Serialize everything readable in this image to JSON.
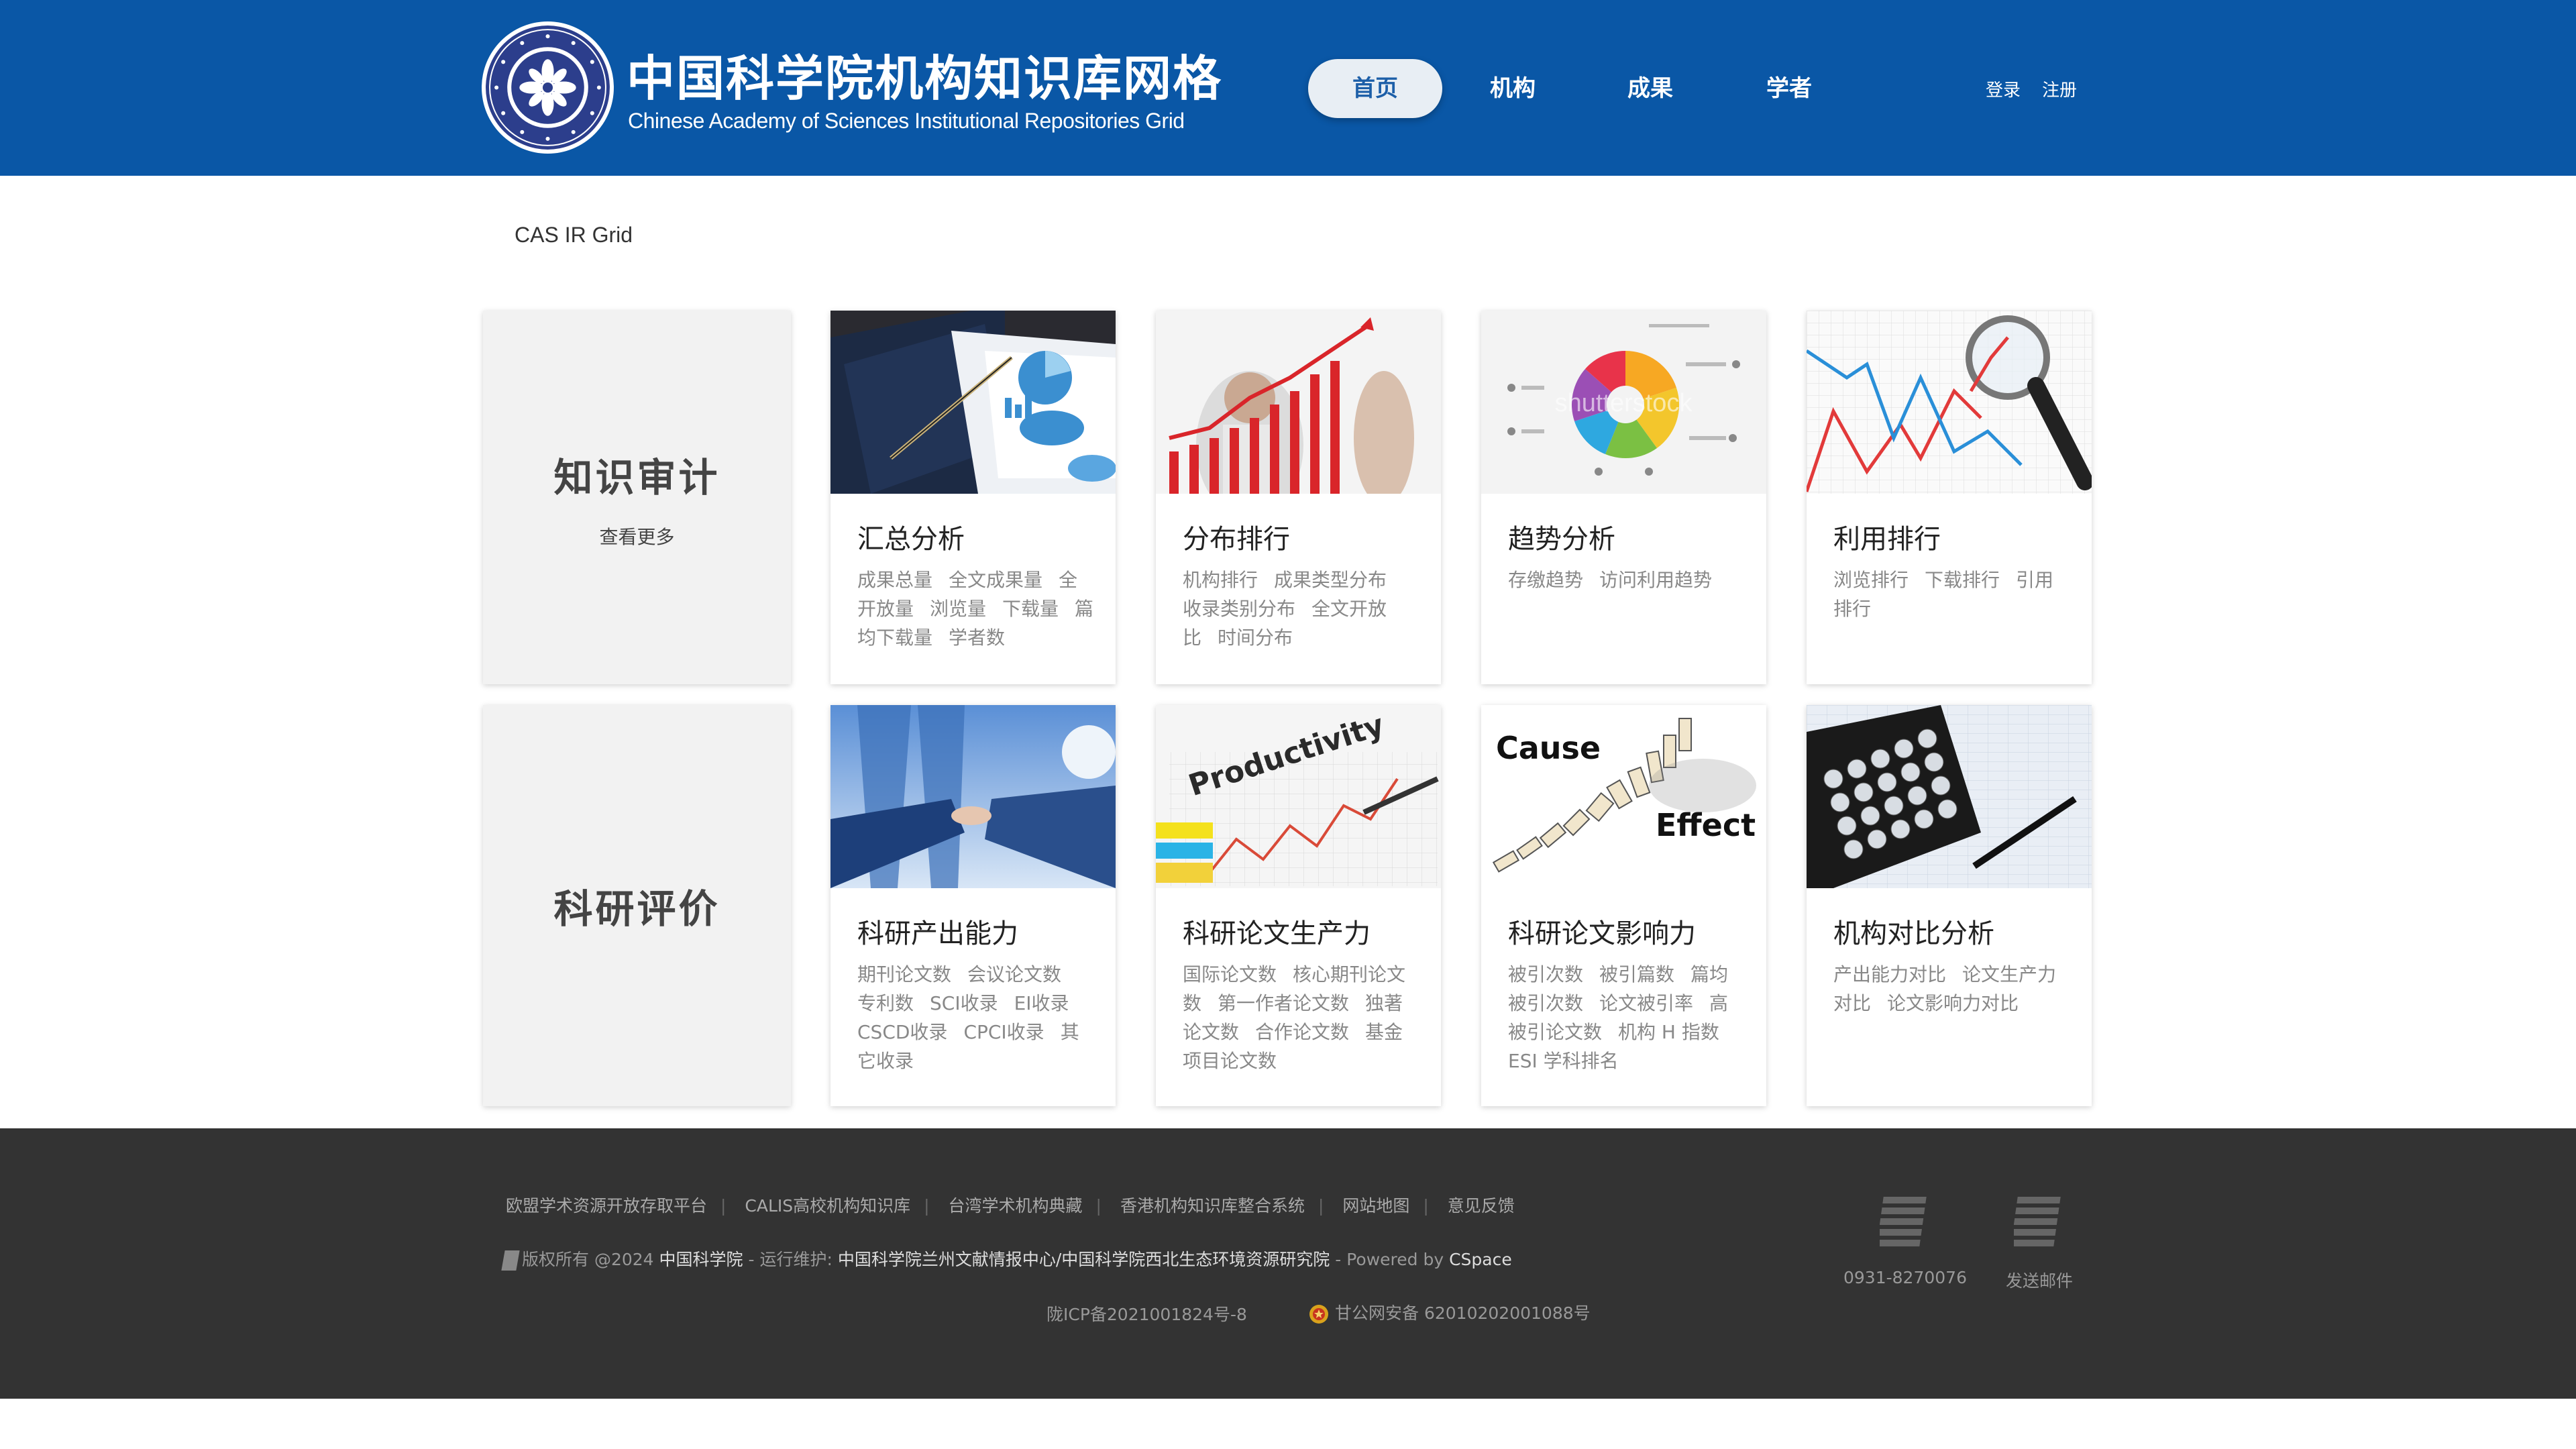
{
  "header": {
    "logo_name": "中国科学院 CHINESE ACADEMY OF SCIENCES",
    "title_cn": "中国科学院机构知识库网格",
    "title_en": "Chinese Academy of Sciences Institutional Repositories Grid",
    "nav": [
      {
        "label": "首页",
        "active": true
      },
      {
        "label": "机构",
        "active": false
      },
      {
        "label": "成果",
        "active": false
      },
      {
        "label": "学者",
        "active": false
      }
    ],
    "login": "登录",
    "register": "注册",
    "colors": {
      "header_bg": "#0a57a6",
      "active_nav_bg": "#e8eef4",
      "active_nav_text": "#1d5fa8"
    }
  },
  "breadcrumb": "CAS IR Grid",
  "sections": [
    {
      "title": "知识审计",
      "more": "查看更多",
      "cards": [
        {
          "title": "汇总分析",
          "items": [
            "成果总量",
            "全文成果量",
            "全开放量",
            "浏览量",
            "下载量",
            "篇均下载量",
            "学者数"
          ]
        },
        {
          "title": "分布排行",
          "items": [
            "机构排行",
            "成果类型分布",
            "收录类别分布",
            "全文开放比",
            "时间分布"
          ]
        },
        {
          "title": "趋势分析",
          "items": [
            "存缴趋势",
            "访问利用趋势"
          ]
        },
        {
          "title": "利用排行",
          "items": [
            "浏览排行",
            "下载排行",
            "引用排行"
          ]
        }
      ]
    },
    {
      "title": "科研评价",
      "cards": [
        {
          "title": "科研产出能力",
          "items": [
            "期刊论文数",
            "会议论文数",
            "专利数",
            "SCI收录",
            "EI收录",
            "CSCD收录",
            "CPCI收录",
            "其它收录"
          ]
        },
        {
          "title": "科研论文生产力",
          "items": [
            "国际论文数",
            "核心期刊论文数",
            "第一作者论文数",
            "独著论文数",
            "合作论文数",
            "基金项目论文数"
          ]
        },
        {
          "title": "科研论文影响力",
          "items": [
            "被引次数",
            "被引篇数",
            "篇均被引次数",
            "论文被引率",
            "高被引论文数",
            "机构 H 指数",
            "ESI 学科排名"
          ]
        },
        {
          "title": "机构对比分析",
          "items": [
            "产出能力对比",
            "论文生产力对比",
            "论文影响力对比"
          ]
        }
      ]
    }
  ],
  "image_text": {
    "watermark": "shutterstock",
    "productivity": "Productivity",
    "cause": "Cause",
    "effect": "Effect"
  },
  "footer": {
    "links": [
      "欧盟学术资源开放存取平台",
      "CALIS高校机构知识库",
      "台湾学术机构典藏",
      "香港机构知识库整合系统",
      "网站地图",
      "意见反馈"
    ],
    "copyright_prefix": "版权所有 @2024",
    "owner": "中国科学院",
    "maintain_label": "- 运行维护:",
    "maintainer": "中国科学院兰州文献情报中心/中国科学院西北生态环境资源研究院",
    "powered_label": "- Powered by",
    "powered": "CSpace",
    "icp": "陇ICP备2021001824号-8",
    "police": "甘公网安备 62010202001088号",
    "phone": "0931-8270076",
    "email": "发送邮件"
  }
}
